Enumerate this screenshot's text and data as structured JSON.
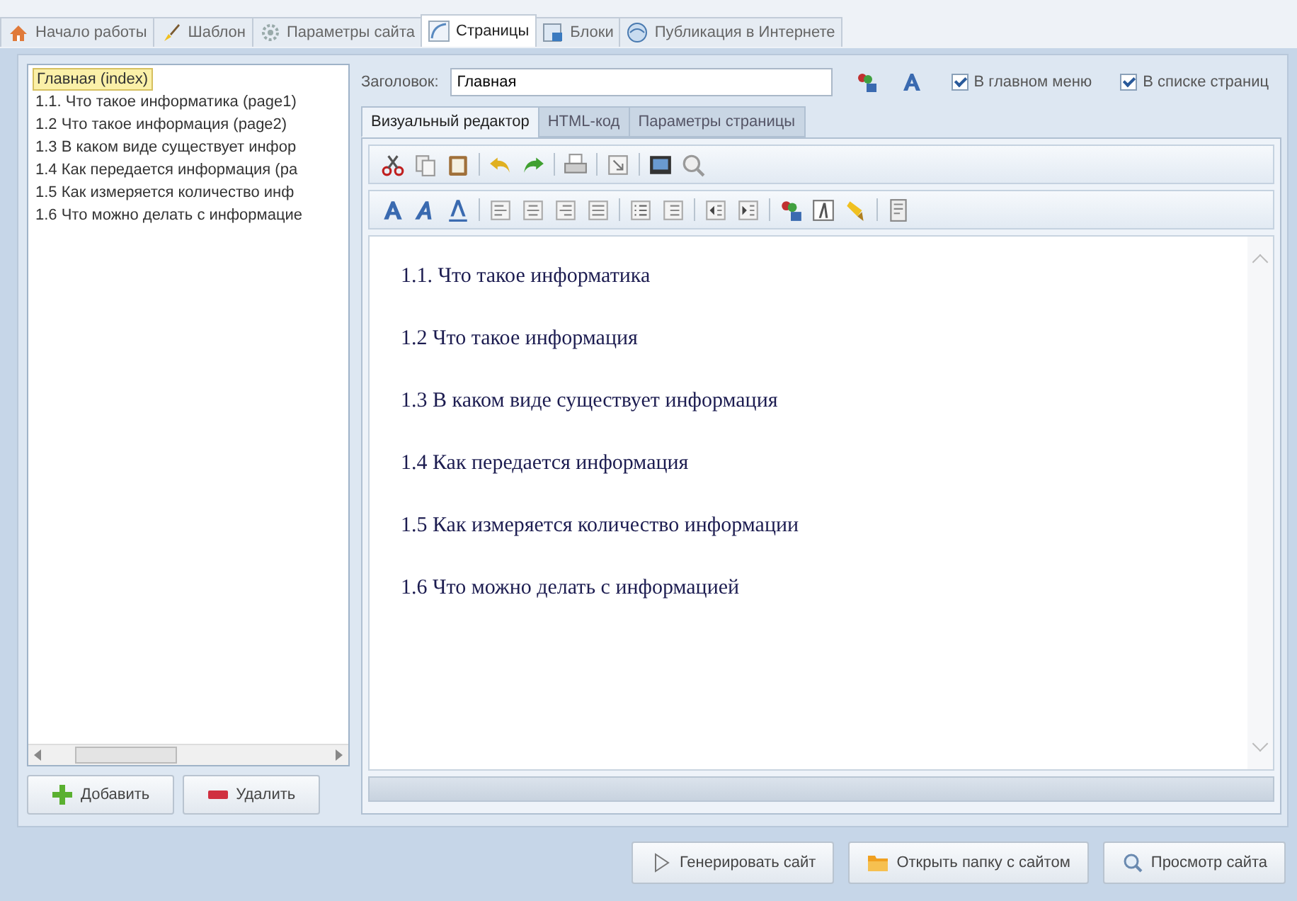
{
  "top_tabs": [
    {
      "label": "Начало работы",
      "selected": false
    },
    {
      "label": "Шаблон",
      "selected": false
    },
    {
      "label": "Параметры сайта",
      "selected": false
    },
    {
      "label": "Страницы",
      "selected": true
    },
    {
      "label": "Блоки",
      "selected": false
    },
    {
      "label": "Публикация в Интернете",
      "selected": false
    }
  ],
  "pages_list": [
    {
      "label": "Главная (index)",
      "selected": true
    },
    {
      "label": "1.1. Что такое информатика (page1)",
      "selected": false
    },
    {
      "label": "1.2 Что такое информация (page2)",
      "selected": false
    },
    {
      "label": "1.3 В каком виде существует инфор",
      "selected": false
    },
    {
      "label": "1.4 Как передается информация (pa",
      "selected": false
    },
    {
      "label": "1.5 Как измеряется количество инф",
      "selected": false
    },
    {
      "label": "1.6 Что можно делать с информацие",
      "selected": false
    }
  ],
  "list_buttons": [
    {
      "label": "Добавить"
    },
    {
      "label": "Удалить"
    }
  ],
  "title_field": {
    "label": "Заголовок:",
    "value": "Главная"
  },
  "checkboxes": [
    {
      "label": "В главном меню",
      "checked": true
    },
    {
      "label": "В списке страниц",
      "checked": true
    }
  ],
  "editor_tabs": [
    {
      "label": "Визуальный редактор",
      "selected": true
    },
    {
      "label": "HTML-код",
      "selected": false
    },
    {
      "label": "Параметры страницы",
      "selected": false
    }
  ],
  "content_lines": [
    "1.1. Что такое информатика",
    "1.2 Что такое информация",
    "1.3 В каком виде существует информация",
    "1.4 Как передается информация",
    "1.5 Как измеряется количество информации",
    "1.6 Что можно делать с информацией"
  ],
  "bottom_buttons": [
    {
      "label": "Генерировать сайт"
    },
    {
      "label": "Открыть папку с сайтом"
    },
    {
      "label": "Просмотр сайта"
    }
  ]
}
